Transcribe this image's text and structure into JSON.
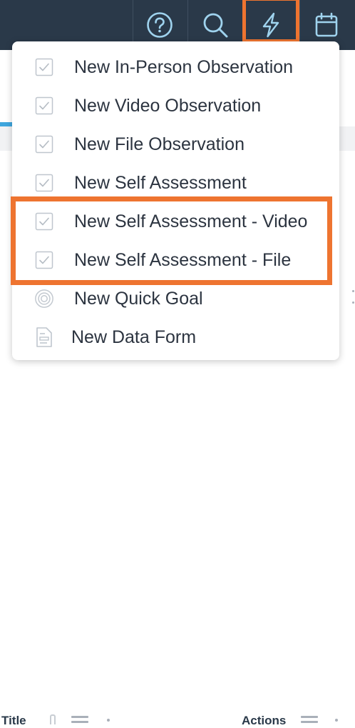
{
  "header": {
    "icons": [
      {
        "name": "help-icon"
      },
      {
        "name": "search-icon"
      },
      {
        "name": "lightning-icon"
      },
      {
        "name": "calendar-icon"
      }
    ],
    "highlight_color": "#ee7430",
    "bar_color": "#2a3949"
  },
  "menu": {
    "items": [
      {
        "label": "New In-Person Observation",
        "icon": "checkbox-icon"
      },
      {
        "label": "New Video Observation",
        "icon": "checkbox-icon"
      },
      {
        "label": "New File Observation",
        "icon": "checkbox-icon"
      },
      {
        "label": "New Self Assessment",
        "icon": "checkbox-icon"
      },
      {
        "label": "New Self Assessment - Video",
        "icon": "checkbox-icon"
      },
      {
        "label": "New Self Assessment - File",
        "icon": "checkbox-icon"
      },
      {
        "label": "New Quick Goal",
        "icon": "target-icon"
      },
      {
        "label": "New Data Form",
        "icon": "form-icon"
      }
    ]
  },
  "table": {
    "col_title": "Title",
    "col_actions": "Actions"
  }
}
